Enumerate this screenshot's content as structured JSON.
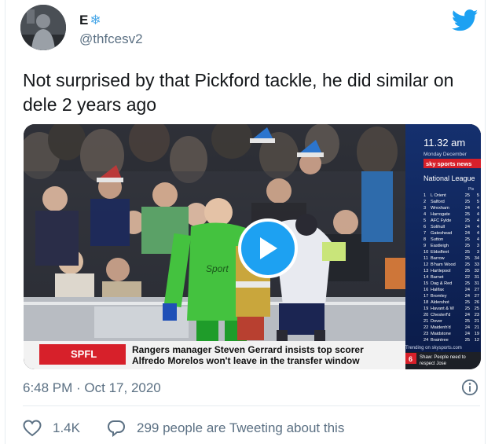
{
  "tweet": {
    "display_name": "E",
    "name_emoji": "❄",
    "handle": "@thfcesv2",
    "text": "Not surprised by that Pickford tackle, he did similar on dele 2 years ago",
    "timestamp": "6:48 PM · Oct 17, 2020",
    "like_count": "1.4K",
    "reply_text": "299 people are Tweeting about this"
  },
  "video": {
    "clock": "11.32 am",
    "day": "Monday December",
    "channel": "sky sports news",
    "league_title": "National League",
    "table_header": "Pts",
    "table": [
      {
        "pos": "1",
        "team": "L Orient",
        "pld": "25",
        "pts": "5"
      },
      {
        "pos": "2",
        "team": "Salford",
        "pld": "25",
        "pts": "5"
      },
      {
        "pos": "3",
        "team": "Wrexham",
        "pld": "24",
        "pts": "4"
      },
      {
        "pos": "4",
        "team": "Harrogate",
        "pld": "25",
        "pts": "4"
      },
      {
        "pos": "5",
        "team": "AFC Fylde",
        "pld": "25",
        "pts": "4"
      },
      {
        "pos": "6",
        "team": "Solihull",
        "pld": "24",
        "pts": "4"
      },
      {
        "pos": "7",
        "team": "Gateshead",
        "pld": "24",
        "pts": "4"
      },
      {
        "pos": "8",
        "team": "Sutton",
        "pld": "25",
        "pts": "4"
      },
      {
        "pos": "9",
        "team": "Eastleigh",
        "pld": "25",
        "pts": "3"
      },
      {
        "pos": "10",
        "team": "Ebbsfleet",
        "pld": "25",
        "pts": "3"
      },
      {
        "pos": "11",
        "team": "Barrow",
        "pld": "25",
        "pts": "34"
      },
      {
        "pos": "12",
        "team": "B'ham Wood",
        "pld": "25",
        "pts": "33"
      },
      {
        "pos": "13",
        "team": "Hartlepool",
        "pld": "25",
        "pts": "32"
      },
      {
        "pos": "14",
        "team": "Barnet",
        "pld": "22",
        "pts": "31"
      },
      {
        "pos": "15",
        "team": "Dag & Red",
        "pld": "25",
        "pts": "31"
      },
      {
        "pos": "16",
        "team": "Halifax",
        "pld": "24",
        "pts": "27"
      },
      {
        "pos": "17",
        "team": "Bromley",
        "pld": "24",
        "pts": "27"
      },
      {
        "pos": "18",
        "team": "Aldershot",
        "pld": "25",
        "pts": "26"
      },
      {
        "pos": "19",
        "team": "Havant & W",
        "pld": "25",
        "pts": "25"
      },
      {
        "pos": "20",
        "team": "Chesterf'd",
        "pld": "24",
        "pts": "23"
      },
      {
        "pos": "21",
        "team": "Dover",
        "pld": "25",
        "pts": "21"
      },
      {
        "pos": "22",
        "team": "Maidenh'd",
        "pld": "24",
        "pts": "21"
      },
      {
        "pos": "23",
        "team": "Maidstone",
        "pld": "24",
        "pts": "19"
      },
      {
        "pos": "24",
        "team": "Braintree",
        "pld": "25",
        "pts": "12"
      }
    ],
    "trending_text": "Trending on skysports.com",
    "trending_number": "6",
    "trending_headline": "Shaw: People need to respect Jose",
    "ticker_tag": "SPFL",
    "ticker_line1": "Rangers manager Steven Gerrard insists top scorer",
    "ticker_line2": "Alfredo Morelos won't leave in the transfer window",
    "shirt_logo": "Sport"
  },
  "colors": {
    "twitter_blue": "#1da1f2",
    "secondary_text": "#5b7083",
    "sky_red": "#d7202a",
    "keeper_green": "#44c23f"
  },
  "icons": [
    "twitter-bird-icon",
    "play-icon",
    "info-icon",
    "heart-icon",
    "reply-bubble-icon"
  ]
}
